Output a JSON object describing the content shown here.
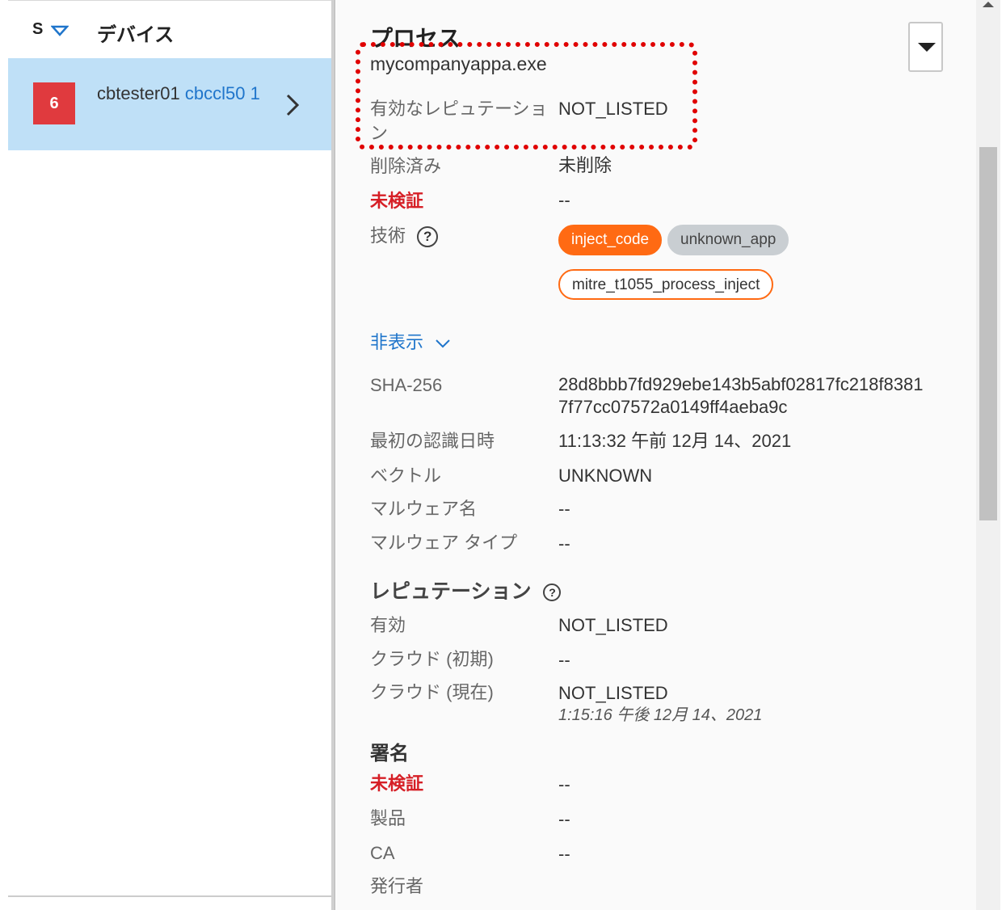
{
  "device_list": {
    "sort_label": "S",
    "column_device": "デバイス",
    "row": {
      "severity": "6",
      "device_name": "cbtester01",
      "device_id": "cbccl50 1"
    }
  },
  "process": {
    "title": "プロセス",
    "name": "mycompanyappa.exe",
    "fields": {
      "effective_reputation_label": "有効なレピュテーション",
      "effective_reputation_value": "NOT_LISTED",
      "deleted_label": "削除済み",
      "deleted_value": "未削除",
      "unverified_label": "未検証",
      "unverified_value": "--",
      "technique_label": "技術"
    },
    "tags": [
      "inject_code",
      "unknown_app",
      "mitre_t1055_process_inject"
    ],
    "hide_label": "非表示",
    "details": {
      "sha_label": "SHA-256",
      "sha_value_line1": "28d8bbb7fd929ebe143b5abf02817fc218f8381",
      "sha_value_line2": "7f77cc07572a0149ff4aeba9c",
      "first_seen_label": "最初の認識日時",
      "first_seen_value": "11:13:32 午前 12月 14、2021",
      "vector_label": "ベクトル",
      "vector_value": "UNKNOWN",
      "malware_name_label": "マルウェア名",
      "malware_name_value": "--",
      "malware_type_label": "マルウェア タイプ",
      "malware_type_value": "--"
    }
  },
  "reputation": {
    "title": "レピュテーション",
    "effective_label": "有効",
    "effective_value": "NOT_LISTED",
    "cloud_initial_label": "クラウド (初期)",
    "cloud_initial_value": "--",
    "cloud_current_label": "クラウド (現在)",
    "cloud_current_value": "NOT_LISTED",
    "cloud_current_time": "1:15:16 午後 12月 14、2021"
  },
  "signature": {
    "title": "署名",
    "unverified_label": "未検証",
    "unverified_value": "--",
    "product_label": "製品",
    "product_value": "--",
    "ca_label": "CA",
    "ca_value": "--",
    "issuer_label": "発行者"
  },
  "colors": {
    "accent_blue": "#1f75cb",
    "severity_red": "#e03a3e",
    "tag_orange": "#ff6a13",
    "selected_row": "#bfe0f7",
    "highlight_red": "#e00000"
  }
}
